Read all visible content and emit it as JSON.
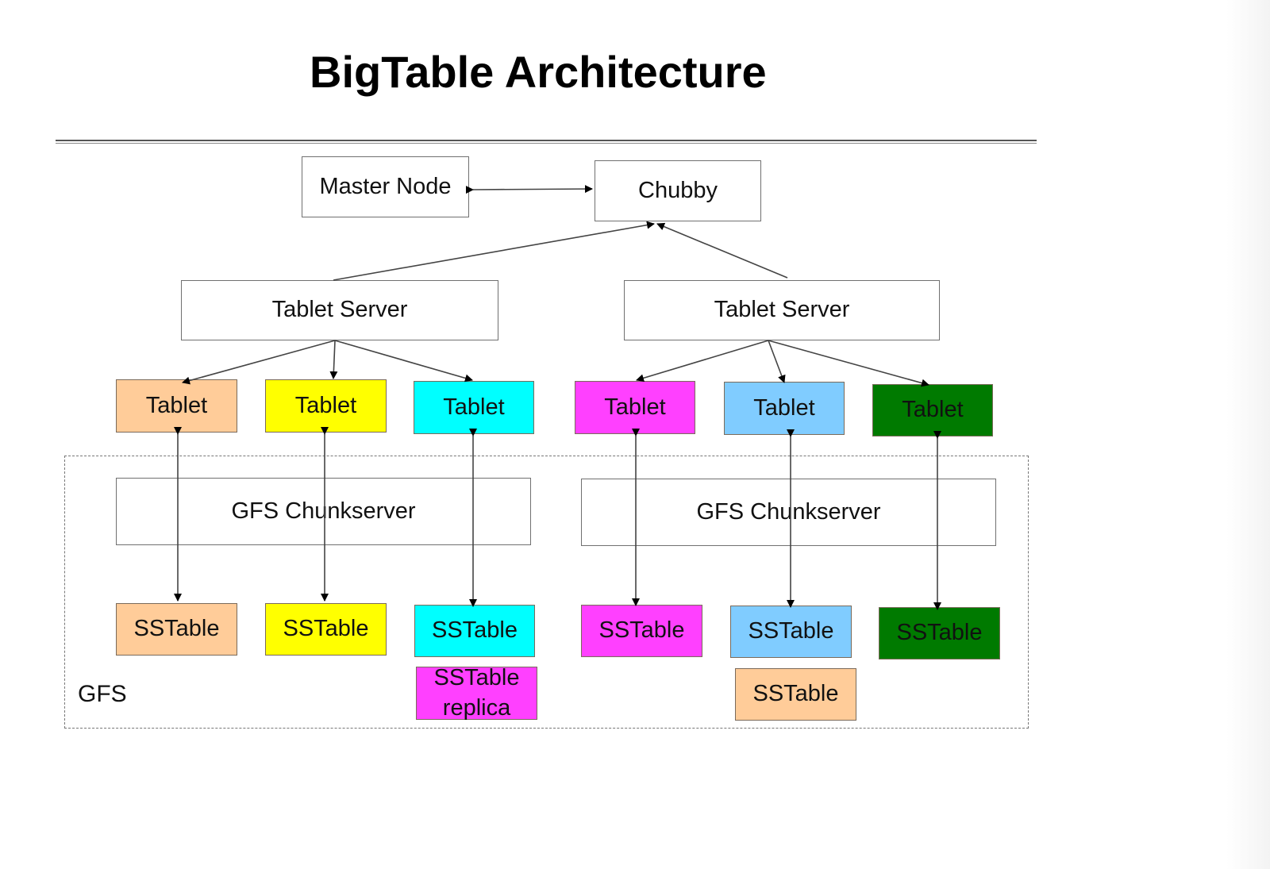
{
  "title": "BigTable Architecture",
  "nodes": {
    "master": "Master Node",
    "chubby": "Chubby",
    "tablet_server_left": "Tablet Server",
    "tablet_server_right": "Tablet Server",
    "gfs_chunkserver_left": "GFS Chunkserver",
    "gfs_chunkserver_right": "GFS Chunkserver",
    "gfs_label": "GFS"
  },
  "tablets": [
    {
      "label": "Tablet",
      "color": "#ffcc99"
    },
    {
      "label": "Tablet",
      "color": "#ffff00"
    },
    {
      "label": "Tablet",
      "color": "#00ffff"
    },
    {
      "label": "Tablet",
      "color": "#ff40ff"
    },
    {
      "label": "Tablet",
      "color": "#80ccff"
    },
    {
      "label": "Tablet",
      "color": "#007a00"
    }
  ],
  "sstables": [
    {
      "label": "SSTable",
      "color": "#ffcc99"
    },
    {
      "label": "SSTable",
      "color": "#ffff00"
    },
    {
      "label": "SSTable",
      "color": "#00ffff"
    },
    {
      "label": "SSTable",
      "color": "#ff40ff"
    },
    {
      "label": "SSTable",
      "color": "#80ccff"
    },
    {
      "label": "SSTable",
      "color": "#007a00"
    }
  ],
  "extra_sstables": [
    {
      "label": "SSTable replica",
      "color": "#ff40ff"
    },
    {
      "label": "SSTable",
      "color": "#ffcc99"
    }
  ]
}
